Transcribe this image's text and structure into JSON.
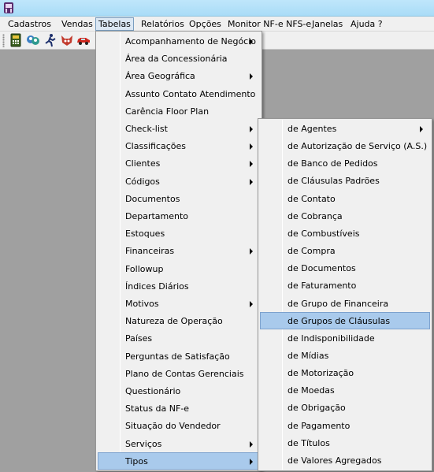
{
  "menubar": {
    "items": [
      {
        "label": "Cadastros"
      },
      {
        "label": "Vendas"
      },
      {
        "label": "Tabelas"
      },
      {
        "label": "Relatórios"
      },
      {
        "label": "Opções"
      },
      {
        "label": "Monitor NF-e NFS-e"
      },
      {
        "label": "Janelas"
      },
      {
        "label": "Ajuda ?"
      }
    ],
    "active": "Tabelas"
  },
  "toolbar": {
    "buttons": [
      {
        "icon": "calculator-icon"
      },
      {
        "icon": "people-chat-icon"
      },
      {
        "icon": "running-man-icon"
      },
      {
        "icon": "mascot-icon"
      },
      {
        "icon": "red-car-icon"
      }
    ]
  },
  "menu_tabelas": {
    "items": [
      {
        "label": "Acompanhamento de Negócio",
        "submenu": true
      },
      {
        "label": "Área da Concessionária",
        "submenu": false
      },
      {
        "label": "Área Geográfica",
        "submenu": true
      },
      {
        "label": "Assunto Contato Atendimento",
        "submenu": false
      },
      {
        "label": "Carência Floor Plan",
        "submenu": false
      },
      {
        "label": "Check-list",
        "submenu": true
      },
      {
        "label": "Classificações",
        "submenu": true
      },
      {
        "label": "Clientes",
        "submenu": true
      },
      {
        "label": "Códigos",
        "submenu": true
      },
      {
        "label": "Documentos",
        "submenu": false
      },
      {
        "label": "Departamento",
        "submenu": false
      },
      {
        "label": "Estoques",
        "submenu": false
      },
      {
        "label": "Financeiras",
        "submenu": true
      },
      {
        "label": "Followup",
        "submenu": false
      },
      {
        "label": "Índices Diários",
        "submenu": false
      },
      {
        "label": "Motivos",
        "submenu": true
      },
      {
        "label": "Natureza de Operação",
        "submenu": false
      },
      {
        "label": "Países",
        "submenu": false
      },
      {
        "label": "Perguntas de Satisfação",
        "submenu": false
      },
      {
        "label": "Plano de Contas Gerenciais",
        "submenu": false
      },
      {
        "label": "Questionário",
        "submenu": false
      },
      {
        "label": "Status da NF-e",
        "submenu": false
      },
      {
        "label": "Situação do Vendedor",
        "submenu": false
      },
      {
        "label": "Serviços",
        "submenu": true
      },
      {
        "label": "Tipos",
        "submenu": true,
        "highlighted": true
      }
    ]
  },
  "menu_tipos": {
    "items": [
      {
        "label": "de Agentes",
        "submenu": true
      },
      {
        "label": "de Autorização de Serviço (A.S.)",
        "submenu": false
      },
      {
        "label": "de Banco de Pedidos",
        "submenu": false
      },
      {
        "label": "de Cláusulas Padrões",
        "submenu": false
      },
      {
        "label": "de Contato",
        "submenu": false
      },
      {
        "label": "de Cobrança",
        "submenu": false
      },
      {
        "label": "de Combustíveis",
        "submenu": false
      },
      {
        "label": "de Compra",
        "submenu": false
      },
      {
        "label": "de Documentos",
        "submenu": false
      },
      {
        "label": "de Faturamento",
        "submenu": false
      },
      {
        "label": "de Grupo de Financeira",
        "submenu": false
      },
      {
        "label": "de Grupos de Cláusulas",
        "submenu": false,
        "highlighted": true
      },
      {
        "label": "de Indisponibilidade",
        "submenu": false
      },
      {
        "label": "de Mídias",
        "submenu": false
      },
      {
        "label": "de Motorização",
        "submenu": false
      },
      {
        "label": "de Moedas",
        "submenu": false
      },
      {
        "label": "de Obrigação",
        "submenu": false
      },
      {
        "label": "de Pagamento",
        "submenu": false
      },
      {
        "label": "de Títulos",
        "submenu": false
      },
      {
        "label": "de Valores Agregados",
        "submenu": false
      }
    ]
  },
  "colors": {
    "titlebar": "#a9dcf7",
    "workspace": "#a0a0a0",
    "menu_bg": "#f0f0f0",
    "highlight_border": "#7da2ce",
    "highlight_fill": "#cfe3f6"
  }
}
